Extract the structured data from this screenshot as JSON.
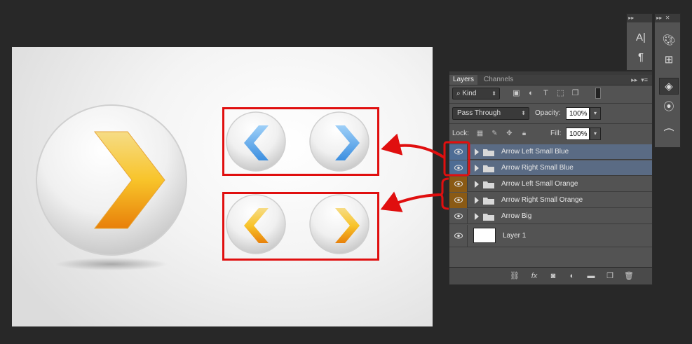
{
  "panel": {
    "tabs": [
      {
        "label": "Layers",
        "active": true
      },
      {
        "label": "Channels",
        "active": false
      }
    ],
    "filter": {
      "kind_label": "Kind"
    },
    "blend_mode": "Pass Through",
    "opacity_label": "Opacity:",
    "opacity_value": "100%",
    "lock_label": "Lock:",
    "fill_label": "Fill:",
    "fill_value": "100%",
    "layers": [
      {
        "name": "Arrow Left Small Blue",
        "type": "group",
        "visible": true,
        "highlight": "#4e6d95"
      },
      {
        "name": "Arrow Right Small Blue",
        "type": "group",
        "visible": true,
        "highlight": "#4e6d95"
      },
      {
        "name": "Arrow Left Small Orange",
        "type": "group",
        "visible": true,
        "highlight": "#8a5a15"
      },
      {
        "name": "Arrow Right Small Orange",
        "type": "group",
        "visible": true,
        "highlight": "#8a5a15"
      },
      {
        "name": "Arrow Big",
        "type": "group",
        "visible": true
      },
      {
        "name": "Layer 1",
        "type": "layer",
        "visible": true
      }
    ],
    "footer_icons": [
      "link-icon",
      "fx-icon",
      "mask-icon",
      "adjustment-icon",
      "folder-icon",
      "new-layer-icon",
      "trash-icon"
    ]
  },
  "colors": {
    "annotation": "#e00f0f",
    "blue_arrow": "#4a9be8",
    "orange_arrow": "#f0a020"
  }
}
